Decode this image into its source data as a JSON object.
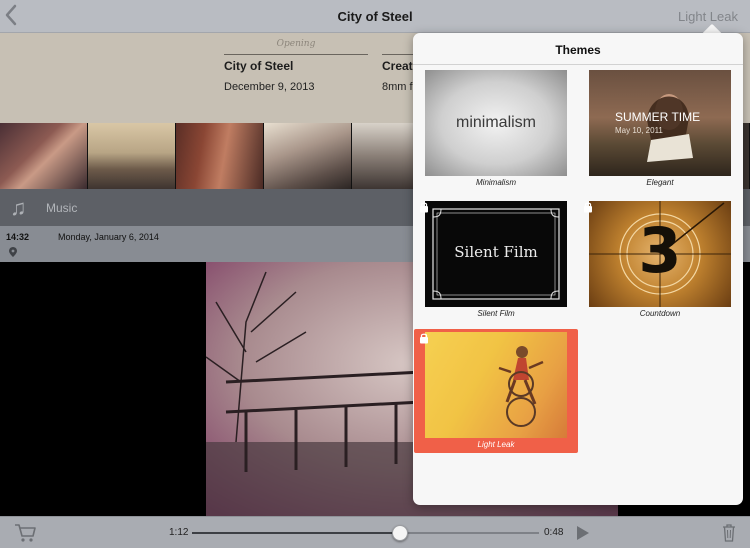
{
  "navbar": {
    "title": "City of Steel",
    "theme_button": "Light Leak"
  },
  "header": {
    "opening_script": "Opening",
    "movie_name": "City of Steel",
    "movie_date": "December 9, 2013",
    "col2_label": "Creat",
    "col2_value": "8mm f"
  },
  "music": {
    "label": "Music"
  },
  "clip": {
    "time": "14:32",
    "date": "Monday, January 6, 2014"
  },
  "playback": {
    "elapsed": "1:12",
    "remaining": "0:48",
    "progress": 0.6
  },
  "popover": {
    "title": "Themes",
    "themes": [
      {
        "name": "Minimalism",
        "thumb_text": "minimalism",
        "locked": false,
        "selected": false
      },
      {
        "name": "Elegant",
        "thumb_text": "SUMMER TIME",
        "thumb_subtext": "May 10, 2011",
        "locked": false,
        "selected": false
      },
      {
        "name": "Silent Film",
        "thumb_text": "Silent Film",
        "locked": true,
        "selected": false
      },
      {
        "name": "Countdown",
        "thumb_text": "3",
        "locked": true,
        "selected": false
      },
      {
        "name": "Light Leak",
        "locked": true,
        "selected": true
      }
    ]
  },
  "colors": {
    "accent_selected": "#f06048",
    "navbar": "#b9bcc2",
    "header": "#c7c0b4"
  },
  "icons": [
    "back-chevron-icon",
    "music-note-icon",
    "location-pin-icon",
    "cart-icon",
    "play-icon",
    "trash-icon",
    "lock-icon"
  ]
}
